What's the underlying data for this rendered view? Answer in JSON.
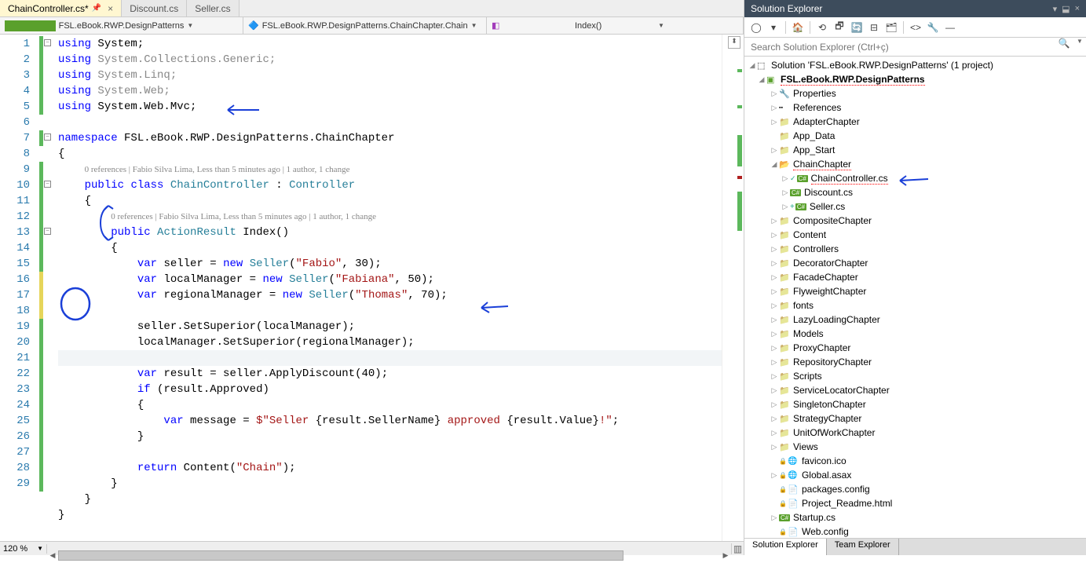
{
  "tabs": [
    {
      "label": "ChainController.cs*",
      "active": true,
      "pinned": true
    },
    {
      "label": "Discount.cs",
      "active": false
    },
    {
      "label": "Seller.cs",
      "active": false
    }
  ],
  "navbar": {
    "project": "FSL.eBook.RWP.DesignPatterns",
    "class": "FSL.eBook.RWP.DesignPatterns.ChainChapter.Chain",
    "member": "Index()"
  },
  "line_numbers": [
    "1",
    "2",
    "3",
    "4",
    "5",
    "6",
    "7",
    "8",
    "",
    "9",
    "10",
    "",
    "11",
    "12",
    "13",
    "14",
    "15",
    "16",
    "17",
    "18",
    "19",
    "20",
    "21",
    "22",
    "23",
    "24",
    "25",
    "26",
    "27",
    "28",
    "29"
  ],
  "codelens1": "0 references | Fabio Silva Lima, Less than 5 minutes ago | 1 author, 1 change",
  "codelens2": "0 references | Fabio Silva Lima, Less than 5 minutes ago | 1 author, 1 change",
  "zoom": "120 %",
  "solution_explorer": {
    "title": "Solution Explorer",
    "search_placeholder": "Search Solution Explorer (Ctrl+ç)",
    "solution_label": "Solution 'FSL.eBook.RWP.DesignPatterns' (1 project)",
    "project_label": "FSL.eBook.RWP.DesignPatterns",
    "nodes": [
      {
        "indent": 2,
        "arrow": "▷",
        "icon": "🔧",
        "label": "Properties"
      },
      {
        "indent": 2,
        "arrow": "▷",
        "icon": "▪▪",
        "label": "References"
      },
      {
        "indent": 2,
        "arrow": "▷",
        "icon": "📁",
        "label": "AdapterChapter"
      },
      {
        "indent": 2,
        "arrow": "",
        "icon": "📁",
        "label": "App_Data"
      },
      {
        "indent": 2,
        "arrow": "▷",
        "icon": "📁",
        "label": "App_Start"
      },
      {
        "indent": 2,
        "arrow": "◢",
        "icon": "📂",
        "label": "ChainChapter",
        "squig": true
      },
      {
        "indent": 3,
        "arrow": "▷",
        "icon": "c#",
        "label": "ChainController.cs",
        "check": true,
        "squig": true
      },
      {
        "indent": 3,
        "arrow": "▷",
        "icon": "c#",
        "label": "Discount.cs"
      },
      {
        "indent": 3,
        "arrow": "▷",
        "icon": "c#",
        "label": "Seller.cs",
        "plus": true
      },
      {
        "indent": 2,
        "arrow": "▷",
        "icon": "📁",
        "label": "CompositeChapter"
      },
      {
        "indent": 2,
        "arrow": "▷",
        "icon": "📁",
        "label": "Content"
      },
      {
        "indent": 2,
        "arrow": "▷",
        "icon": "📁",
        "label": "Controllers"
      },
      {
        "indent": 2,
        "arrow": "▷",
        "icon": "📁",
        "label": "DecoratorChapter"
      },
      {
        "indent": 2,
        "arrow": "▷",
        "icon": "📁",
        "label": "FacadeChapter"
      },
      {
        "indent": 2,
        "arrow": "▷",
        "icon": "📁",
        "label": "FlyweightChapter"
      },
      {
        "indent": 2,
        "arrow": "▷",
        "icon": "📁",
        "label": "fonts"
      },
      {
        "indent": 2,
        "arrow": "▷",
        "icon": "📁",
        "label": "LazyLoadingChapter"
      },
      {
        "indent": 2,
        "arrow": "▷",
        "icon": "📁",
        "label": "Models"
      },
      {
        "indent": 2,
        "arrow": "▷",
        "icon": "📁",
        "label": "ProxyChapter"
      },
      {
        "indent": 2,
        "arrow": "▷",
        "icon": "📁",
        "label": "RepositoryChapter"
      },
      {
        "indent": 2,
        "arrow": "▷",
        "icon": "📁",
        "label": "Scripts"
      },
      {
        "indent": 2,
        "arrow": "▷",
        "icon": "📁",
        "label": "ServiceLocatorChapter"
      },
      {
        "indent": 2,
        "arrow": "▷",
        "icon": "📁",
        "label": "SingletonChapter"
      },
      {
        "indent": 2,
        "arrow": "▷",
        "icon": "📁",
        "label": "StrategyChapter"
      },
      {
        "indent": 2,
        "arrow": "▷",
        "icon": "📁",
        "label": "UnitOfWorkChapter"
      },
      {
        "indent": 2,
        "arrow": "▷",
        "icon": "📁",
        "label": "Views"
      },
      {
        "indent": 2,
        "arrow": "",
        "icon": "🌐",
        "label": "favicon.ico",
        "lock": true
      },
      {
        "indent": 2,
        "arrow": "▷",
        "icon": "🌐",
        "label": "Global.asax",
        "lock": true
      },
      {
        "indent": 2,
        "arrow": "",
        "icon": "📄",
        "label": "packages.config",
        "lock": true
      },
      {
        "indent": 2,
        "arrow": "",
        "icon": "📄",
        "label": "Project_Readme.html",
        "lock": true
      },
      {
        "indent": 2,
        "arrow": "▷",
        "icon": "c#",
        "label": "Startup.cs"
      },
      {
        "indent": 2,
        "arrow": "",
        "icon": "📄",
        "label": "Web.config",
        "lock": true
      }
    ],
    "bottom_tabs": [
      {
        "label": "Solution Explorer",
        "active": true
      },
      {
        "label": "Team Explorer",
        "active": false
      }
    ]
  }
}
